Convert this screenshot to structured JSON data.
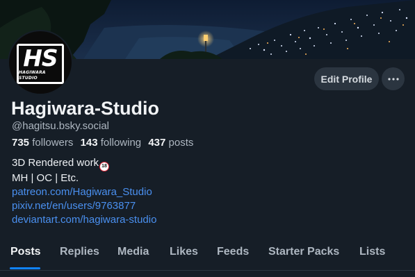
{
  "profile": {
    "display_name": "Hagiwara-Studio",
    "handle": "@hagitsu.bsky.social",
    "avatar": {
      "logo_text": "HS",
      "logo_subtext": "HAGIWARA STUDIO"
    },
    "stats": {
      "followers_count": "735",
      "followers_label": "followers",
      "following_count": "143",
      "following_label": "following",
      "posts_count": "437",
      "posts_label": "posts"
    },
    "bio": {
      "line1": "3D Rendered work",
      "badge": "18",
      "line2": "MH | OC | Etc.",
      "links": [
        "patreon.com/Hagiwara_Studio",
        "pixiv.net/en/users/9763877",
        "deviantart.com/hagiwara-studio"
      ]
    }
  },
  "actions": {
    "edit_profile_label": "Edit Profile",
    "more_label": "···"
  },
  "tabs": [
    {
      "label": "Posts",
      "active": true
    },
    {
      "label": "Replies",
      "active": false
    },
    {
      "label": "Media",
      "active": false
    },
    {
      "label": "Likes",
      "active": false
    },
    {
      "label": "Feeds",
      "active": false
    },
    {
      "label": "Starter Packs",
      "active": false
    },
    {
      "label": "Lists",
      "active": false
    }
  ],
  "colors": {
    "background": "#161e27",
    "link": "#4a90f0",
    "tab_indicator": "#1083fe",
    "button_bg": "#2b3540",
    "muted_text": "#aeb7c1"
  }
}
